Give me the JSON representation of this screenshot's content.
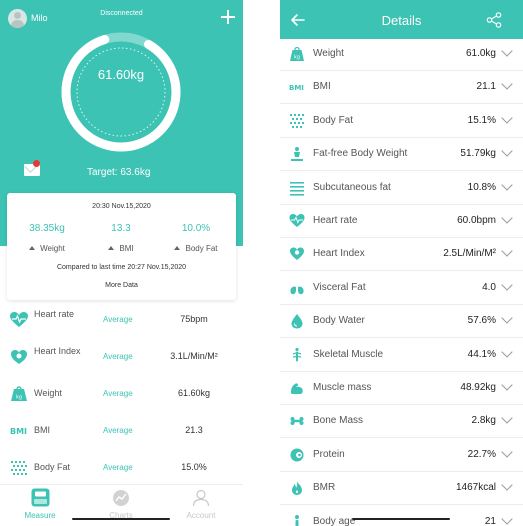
{
  "left": {
    "user_name": "Milo",
    "connection_status": "Disconnected",
    "current_weight": "61.60kg",
    "target": "Target: 63.6kg",
    "card": {
      "time": "20:30 Nov.15,2020",
      "metrics": [
        {
          "value": "38.35kg",
          "label": "Weight"
        },
        {
          "value": "13.3",
          "label": "BMI"
        },
        {
          "value": "10.0%",
          "label": "Body Fat"
        }
      ],
      "compare": "Compared to last time 20:27 Nov.15,2020",
      "more": "More Data"
    },
    "rows": [
      {
        "name": "Heart rate",
        "status": "Average",
        "value": "75bpm",
        "icon": "heart-icon"
      },
      {
        "name": "Heart Index",
        "status": "Average",
        "value": "3.1L/Min/M²",
        "icon": "heart-index-icon"
      },
      {
        "name": "Weight",
        "status": "Average",
        "value": "61.60kg",
        "icon": "weight-icon"
      },
      {
        "name": "BMI",
        "status": "Average",
        "value": "21.3",
        "icon": "bmi-icon"
      },
      {
        "name": "Body Fat",
        "status": "Average",
        "value": "15.0%",
        "icon": "body-fat-icon"
      }
    ],
    "tabs": [
      {
        "label": "Measure",
        "active": true,
        "icon": "scale-icon"
      },
      {
        "label": "Charts",
        "active": false,
        "icon": "chart-icon"
      },
      {
        "label": "Account",
        "active": false,
        "icon": "account-icon"
      }
    ]
  },
  "right": {
    "title": "Details",
    "rows": [
      {
        "name": "Weight",
        "value": "61.0kg",
        "icon": "weight-icon"
      },
      {
        "name": "BMI",
        "value": "21.1",
        "icon": "bmi-icon"
      },
      {
        "name": "Body Fat",
        "value": "15.1%",
        "icon": "body-fat-icon"
      },
      {
        "name": "Fat-free Body Weight",
        "value": "51.79kg",
        "icon": "fat-free-icon"
      },
      {
        "name": "Subcutaneous fat",
        "value": "10.8%",
        "icon": "subcutaneous-fat-icon"
      },
      {
        "name": "Heart rate",
        "value": "60.0bpm",
        "icon": "heart-icon"
      },
      {
        "name": "Heart Index",
        "value": "2.5L/Min/M²",
        "icon": "heart-index-icon"
      },
      {
        "name": "Visceral Fat",
        "value": "4.0",
        "icon": "visceral-fat-icon"
      },
      {
        "name": "Body Water",
        "value": "57.6%",
        "icon": "water-drop-icon"
      },
      {
        "name": "Skeletal Muscle",
        "value": "44.1%",
        "icon": "skeletal-muscle-icon"
      },
      {
        "name": "Muscle mass",
        "value": "48.92kg",
        "icon": "muscle-icon"
      },
      {
        "name": "Bone Mass",
        "value": "2.8kg",
        "icon": "bone-icon"
      },
      {
        "name": "Protein",
        "value": "22.7%",
        "icon": "protein-icon"
      },
      {
        "name": "BMR",
        "value": "1467kcal",
        "icon": "flame-icon"
      },
      {
        "name": "Body age",
        "value": "21",
        "icon": "body-age-icon"
      }
    ]
  },
  "colors": {
    "accent": "#3cc3b4",
    "badge": "#e53935"
  }
}
